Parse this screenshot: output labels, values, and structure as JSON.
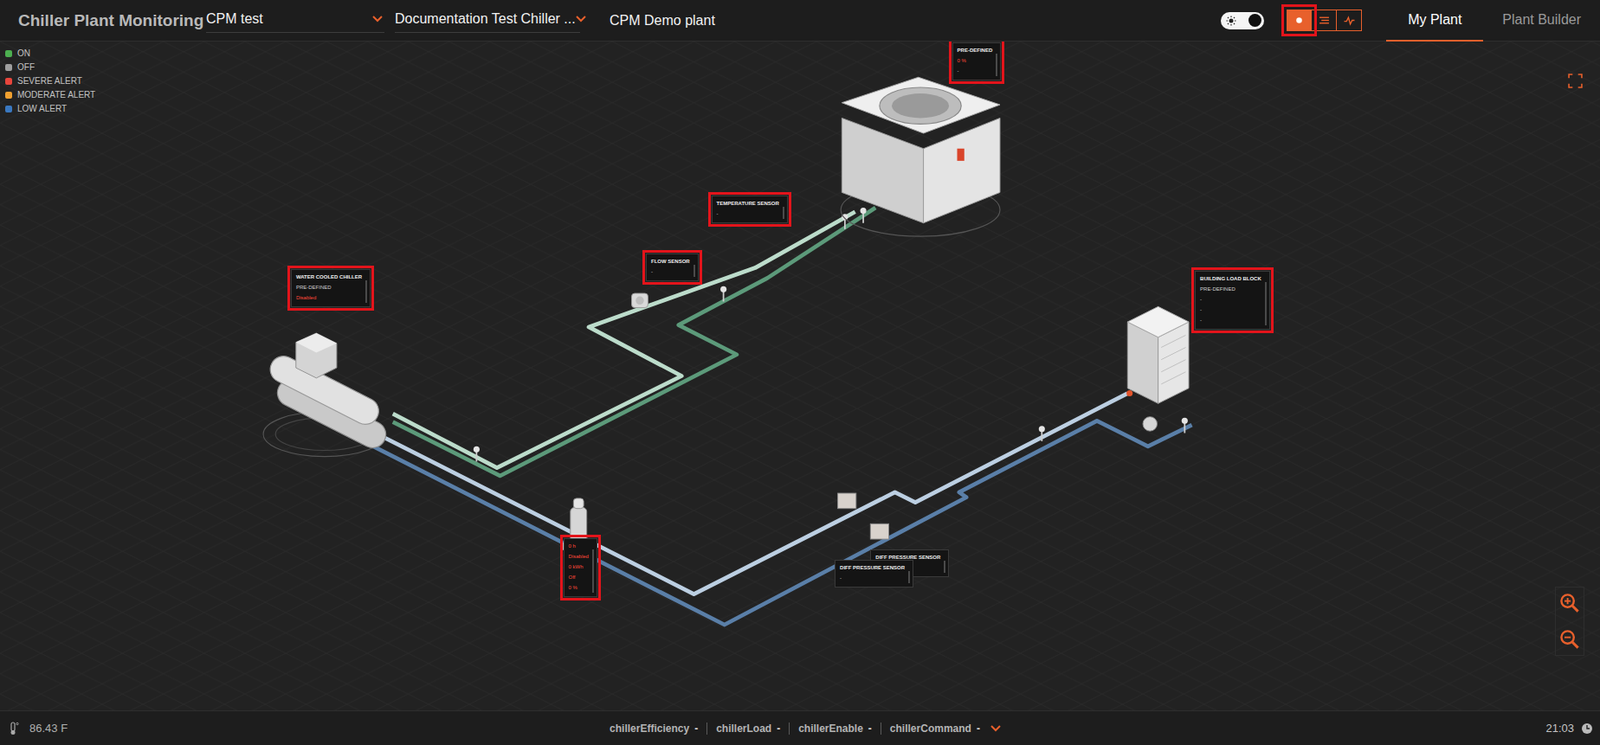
{
  "header": {
    "title": "Chiller Plant Monitoring",
    "dropdowns": [
      {
        "label": "CPM test"
      },
      {
        "label": "Documentation Test Chiller ..."
      }
    ],
    "plant_name": "CPM Demo plant",
    "theme_toggle": {
      "on": true
    },
    "view_buttons": [
      {
        "kind": "plant",
        "selected": true,
        "highlighted": true
      },
      {
        "kind": "list",
        "selected": false,
        "highlighted": false
      },
      {
        "kind": "trend",
        "selected": false,
        "highlighted": false
      }
    ],
    "tabs": [
      {
        "label": "My Plant",
        "selected": true
      },
      {
        "label": "Plant Builder",
        "selected": false
      }
    ]
  },
  "legend": [
    {
      "label": "ON",
      "color": "#4caf50"
    },
    {
      "label": "OFF",
      "color": "#9e9e9e"
    },
    {
      "label": "SEVERE ALERT",
      "color": "#e8453c"
    },
    {
      "label": "MODERATE ALERT",
      "color": "#f0a030"
    },
    {
      "label": "LOW ALERT",
      "color": "#3a78c0"
    }
  ],
  "cards": [
    {
      "kind": "chiller",
      "title": "WATER COOLED CHILLER",
      "highlighted": true,
      "lines": [
        {
          "text": "PRE-DEFINED",
          "alert": false
        },
        {
          "text": "Disabled",
          "alert": true
        }
      ]
    },
    {
      "kind": "tower",
      "title": "PRE-DEFINED",
      "highlighted": true,
      "lines": [
        {
          "text": "0 %",
          "alert": true
        },
        {
          "text": "-",
          "alert": false
        }
      ]
    },
    {
      "kind": "temperature",
      "title": "TEMPERATURE SENSOR",
      "highlighted": true,
      "lines": [
        {
          "text": "-",
          "alert": false
        }
      ]
    },
    {
      "kind": "flow",
      "title": "FLOW SENSOR",
      "highlighted": true,
      "lines": [
        {
          "text": "-",
          "alert": false
        }
      ]
    },
    {
      "kind": "building",
      "title": "BUILDING LOAD BLOCK",
      "highlighted": true,
      "lines": [
        {
          "text": "PRE-DEFINED",
          "alert": false
        },
        {
          "text": "-",
          "alert": false
        },
        {
          "text": "-",
          "alert": false
        },
        {
          "text": "-",
          "alert": false
        }
      ]
    },
    {
      "kind": "pump",
      "title": "",
      "highlighted": true,
      "lines": [
        {
          "text": "0 h",
          "alert": true
        },
        {
          "text": "Disabled",
          "alert": true
        },
        {
          "text": "0 kWh",
          "alert": true
        },
        {
          "text": "Off",
          "alert": true
        },
        {
          "text": "0 %",
          "alert": true
        }
      ]
    },
    {
      "kind": "diff1",
      "title": "DIFF PRESSURE SENSOR",
      "highlighted": false,
      "lines": [
        {
          "text": "-",
          "alert": false
        }
      ]
    },
    {
      "kind": "diff2",
      "title": "DIFF PRESSURE SENSOR",
      "highlighted": false,
      "lines": [
        {
          "text": "-",
          "alert": false
        }
      ]
    }
  ],
  "status_bar": {
    "temperature": "86.43 F",
    "points": [
      {
        "label": "chillerEfficiency",
        "value": "-"
      },
      {
        "label": "chillerLoad",
        "value": "-"
      },
      {
        "label": "chillerEnable",
        "value": "-"
      },
      {
        "label": "chillerCommand",
        "value": "-"
      }
    ],
    "time": "21:03"
  }
}
